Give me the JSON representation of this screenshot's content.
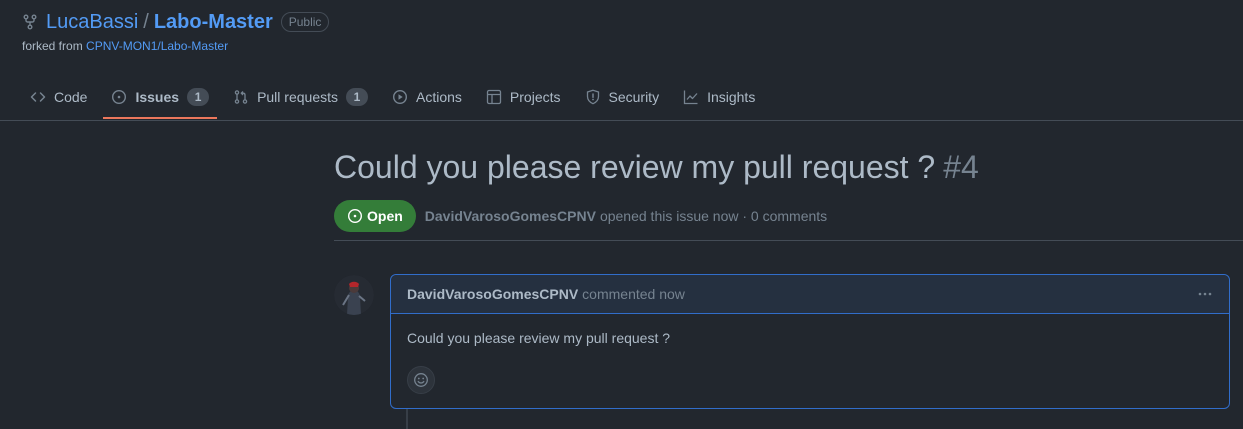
{
  "repo": {
    "owner": "LucaBassi",
    "separator": "/",
    "name": "Labo-Master",
    "visibility": "Public",
    "forked_prefix": "forked from",
    "forked_from": "CPNV-MON1/Labo-Master",
    "icon": "repo-forked-icon"
  },
  "tabs": [
    {
      "label": "Code",
      "icon": "code-icon"
    },
    {
      "label": "Issues",
      "icon": "issue-opened-icon",
      "count": "1",
      "selected": true
    },
    {
      "label": "Pull requests",
      "icon": "git-pull-request-icon",
      "count": "1"
    },
    {
      "label": "Actions",
      "icon": "play-icon"
    },
    {
      "label": "Projects",
      "icon": "table-icon"
    },
    {
      "label": "Security",
      "icon": "shield-icon"
    },
    {
      "label": "Insights",
      "icon": "graph-icon"
    }
  ],
  "issue": {
    "title": "Could you please review my pull request ?",
    "number": "#4",
    "state": "Open",
    "author": "DavidVarosoGomesCPNV",
    "meta_text": "opened this issue now · 0 comments"
  },
  "comment": {
    "author": "DavidVarosoGomesCPNV",
    "time_text": "commented now",
    "body": "Could you please review my pull request ?",
    "menu_icon": "kebab-horizontal-icon",
    "reaction_icon": "smiley-icon"
  },
  "colors": {
    "background": "#22272e",
    "link": "#539bf5",
    "open_state": "#347d39",
    "selected_tab_underline": "#ec775c",
    "comment_border": "#316dca"
  }
}
